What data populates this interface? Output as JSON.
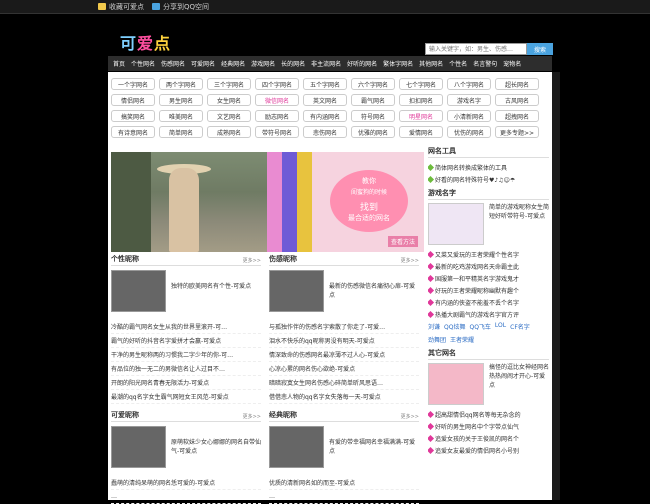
{
  "topbar": {
    "bookmark": "收藏可爱点",
    "share": "分享到QQ空间"
  },
  "logo": {
    "a": "可",
    "b": "爱",
    "c": "点"
  },
  "search": {
    "placeholder": "输入关键字，如：男生、伤感…",
    "button": "搜索"
  },
  "nav": [
    "首页",
    "个性网名",
    "伤感网名",
    "可爱网名",
    "经典网名",
    "游戏网名",
    "长的网名",
    "非主流网名",
    "好听的网名",
    "繁体字网名",
    "其他网名",
    "个性名",
    "名言警句",
    "宠物名"
  ],
  "tags": [
    "一个字网名",
    "两个字网名",
    "三个字网名",
    "四个字网名",
    "五个字网名",
    "六个字网名",
    "七个字网名",
    "八个字网名",
    "超长网名",
    "情侣网名",
    "男生网名",
    "女生网名",
    "微信网名",
    "英文网名",
    "霸气网名",
    "扣扣网名",
    "游戏名字",
    "古风网名",
    "搞笑网名",
    "唯美网名",
    "文艺网名",
    "励志网名",
    "有内涵网名",
    "符号网名",
    "明星网名",
    "小清新网名",
    "超拽网名",
    "有诗意网名",
    "简单网名",
    "成熟网名",
    "带符号网名",
    "悲伤网名",
    "优雅的网名",
    "爱情网名",
    "忧伤的网名",
    "更多专题>>"
  ],
  "pink_tags": [
    12,
    24
  ],
  "banner": {
    "line1": "教你",
    "line2": "闺蜜狗的时候",
    "line3": "找到",
    "line4": "最合适的网名",
    "look": "查看方法"
  },
  "right": {
    "tools_title": "网名工具",
    "tools": [
      "简体网名转换成繁体的工具",
      "好看的网名特殊符号♥♪♫☺☂"
    ],
    "game_title": "游戏名字",
    "game_feat": "简单的游戏昵称女生简短好听带符号-可爱点",
    "game_list": [
      "又菜又爱玩的王者荣耀个性名字",
      "最新的吃鸡游戏网名天命霸主此",
      "国服第一和平精英名字游戏鬼才",
      "好玩的王者荣耀昵称幽默有趣个",
      "有内涵的侠盗不能羞不丢个名字",
      "热播大剧霸气的游戏名字官方评"
    ],
    "game_links": [
      "刘谦",
      "QQ炫舞",
      "QQ飞车",
      "LOL",
      "CF名字",
      "劲舞团",
      "王者荣耀"
    ],
    "other_title": "其它网名",
    "other_feat": "搞怪的逗比女神经网名热热闹闹才开心-可爱点",
    "other_list": [
      "超高甜情侣qq网名等每无杂念的",
      "好听的男生网名中个字带点仙气",
      "追爱女孩的关于王俊凯的网名个",
      "追爱女友最爱的情侣网名小号别"
    ]
  },
  "sections": [
    {
      "title": "个性昵称",
      "more": "更多>>",
      "feat": "独特的欧美网名有个性-可爱点",
      "list": [
        "冷酷的霸气网名女生从我的世界里滚开-可…",
        "霸气的好听的抖音名字爱拼才会赢-可爱点",
        "干净的男生昵称两的习惯我二字少年的你-可…",
        "有品位的独一无二的男微信名让人过目不…",
        "开朗的阳光网名青春无限活力-可爱点",
        "最潮的qq名字女生霸气网短女王风范-可爱点"
      ]
    },
    {
      "title": "伤感昵称",
      "more": "更多>>",
      "feat": "最新的伤感微信名痛彻心扉-可爱点",
      "list": [
        "与孤独作伴的伤感名字索散了你走了-可爱…",
        "泪水不快乐的qq昵称男没有明天-可爱点",
        "情深致命的伤感网名最凉薄不过人心-可爱点",
        "心凉心累的网名伤心欲绝-可爱点",
        "暗暗寂寞女生网名伤感心碎简单昕风思语…",
        "借借悲人物的qq名字女失落每一天-可爱点"
      ]
    },
    {
      "title": "可爱昵称",
      "more": "更多>>",
      "feat": "原萌软妹少女心娜娜的网名自带仙气-可爱点",
      "list": [
        "蠢萌的清纯呆萌的网名恁可爱的-可爱点",
        "…"
      ]
    },
    {
      "title": "经典昵称",
      "more": "更多>>",
      "feat": "有爱的带幸福网名幸福满满-可爱点",
      "list": [
        "优质的清新网名如的而至-可爱点",
        "…"
      ]
    }
  ]
}
